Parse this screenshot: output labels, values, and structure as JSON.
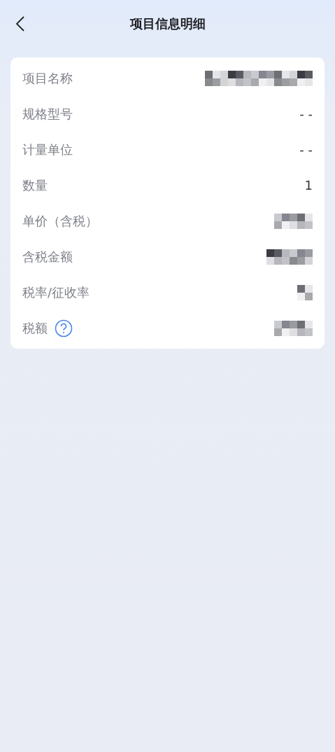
{
  "nav": {
    "title": "项目信息明细"
  },
  "rows": [
    {
      "label": "项目名称",
      "kind": "redacted",
      "help": false
    },
    {
      "label": "规格型号",
      "kind": "text",
      "value": "- -",
      "help": false
    },
    {
      "label": "计量单位",
      "kind": "text",
      "value": "- -",
      "help": false
    },
    {
      "label": "数量",
      "kind": "text",
      "value": "1",
      "help": false
    },
    {
      "label": "单价（含税）",
      "kind": "redacted",
      "help": false
    },
    {
      "label": "含税金额",
      "kind": "redacted",
      "help": false
    },
    {
      "label": "税率/征收率",
      "kind": "redacted",
      "help": false
    },
    {
      "label": "税额",
      "kind": "redacted",
      "help": true
    }
  ]
}
